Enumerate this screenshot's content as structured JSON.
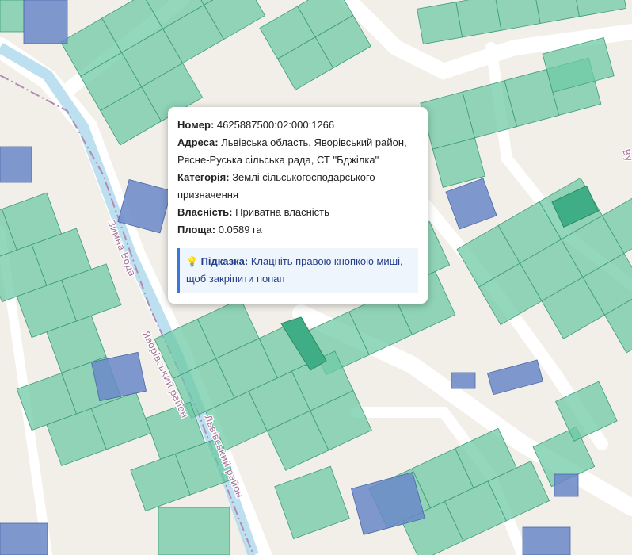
{
  "popup": {
    "rows": [
      {
        "label": "Номер:",
        "value": "4625887500:02:000:1266"
      },
      {
        "label": "Адреса:",
        "value": "Львівська область, Яворівський район, Рясне-Руська сільська рада, СТ \"Бджілка\""
      },
      {
        "label": "Категорія:",
        "value": "Землі сільськогосподарського призначення"
      },
      {
        "label": "Власність:",
        "value": "Приватна власність"
      },
      {
        "label": "Площа:",
        "value": "0.0589 га"
      }
    ],
    "hint": {
      "icon": "lightbulb-icon",
      "label": "Підказка:",
      "text": "Клацніть правою кнопкою миші, щоб закріпити попап"
    }
  },
  "map": {
    "labels": {
      "stream": "Зимна Вода",
      "district1": "Яворівський район",
      "district2": "Львівський район",
      "street_partial": "Ву"
    },
    "colors": {
      "parcel": "#6fc9a6",
      "state_parcel": "#6a88c8",
      "selected": "#3fae86"
    }
  }
}
